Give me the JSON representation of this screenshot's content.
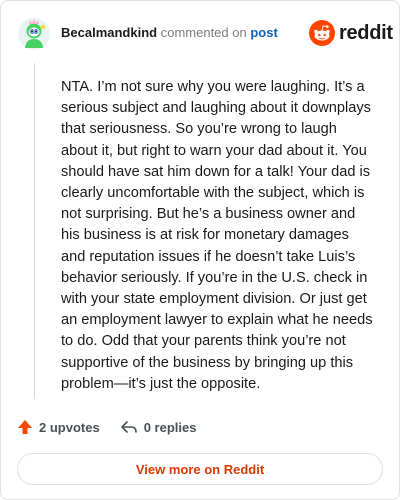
{
  "header": {
    "author": "Becalmandkind",
    "action_text": "commented on",
    "post_link": "post",
    "brand": "reddit"
  },
  "comment": {
    "body": "NTA. I’m not sure why you were laughing. It’s a serious subject and laughing about it downplays that seriousness. So you’re wrong to laugh about it, but right to warn your dad about it. You should have sat him down for a talk! Your dad is clearly uncomfortable with the subject, which is not surprising. But he’s a business owner and his business is at risk for monetary damages and reputation issues if he doesn’t take Luis’s behavior seriously. If you’re in the U.S. check in with your state employment division. Or just get an employment lawyer to explain what he needs to do. Odd that your parents think you’re not supportive of the business by bringing up this problem—it’s just the opposite."
  },
  "actions": {
    "upvotes": "2 upvotes",
    "replies": "0 replies"
  },
  "footer": {
    "view_more": "View more on Reddit"
  },
  "colors": {
    "accent": "#ff4500",
    "link": "#0f62b5",
    "view_more": "#d93a00"
  }
}
